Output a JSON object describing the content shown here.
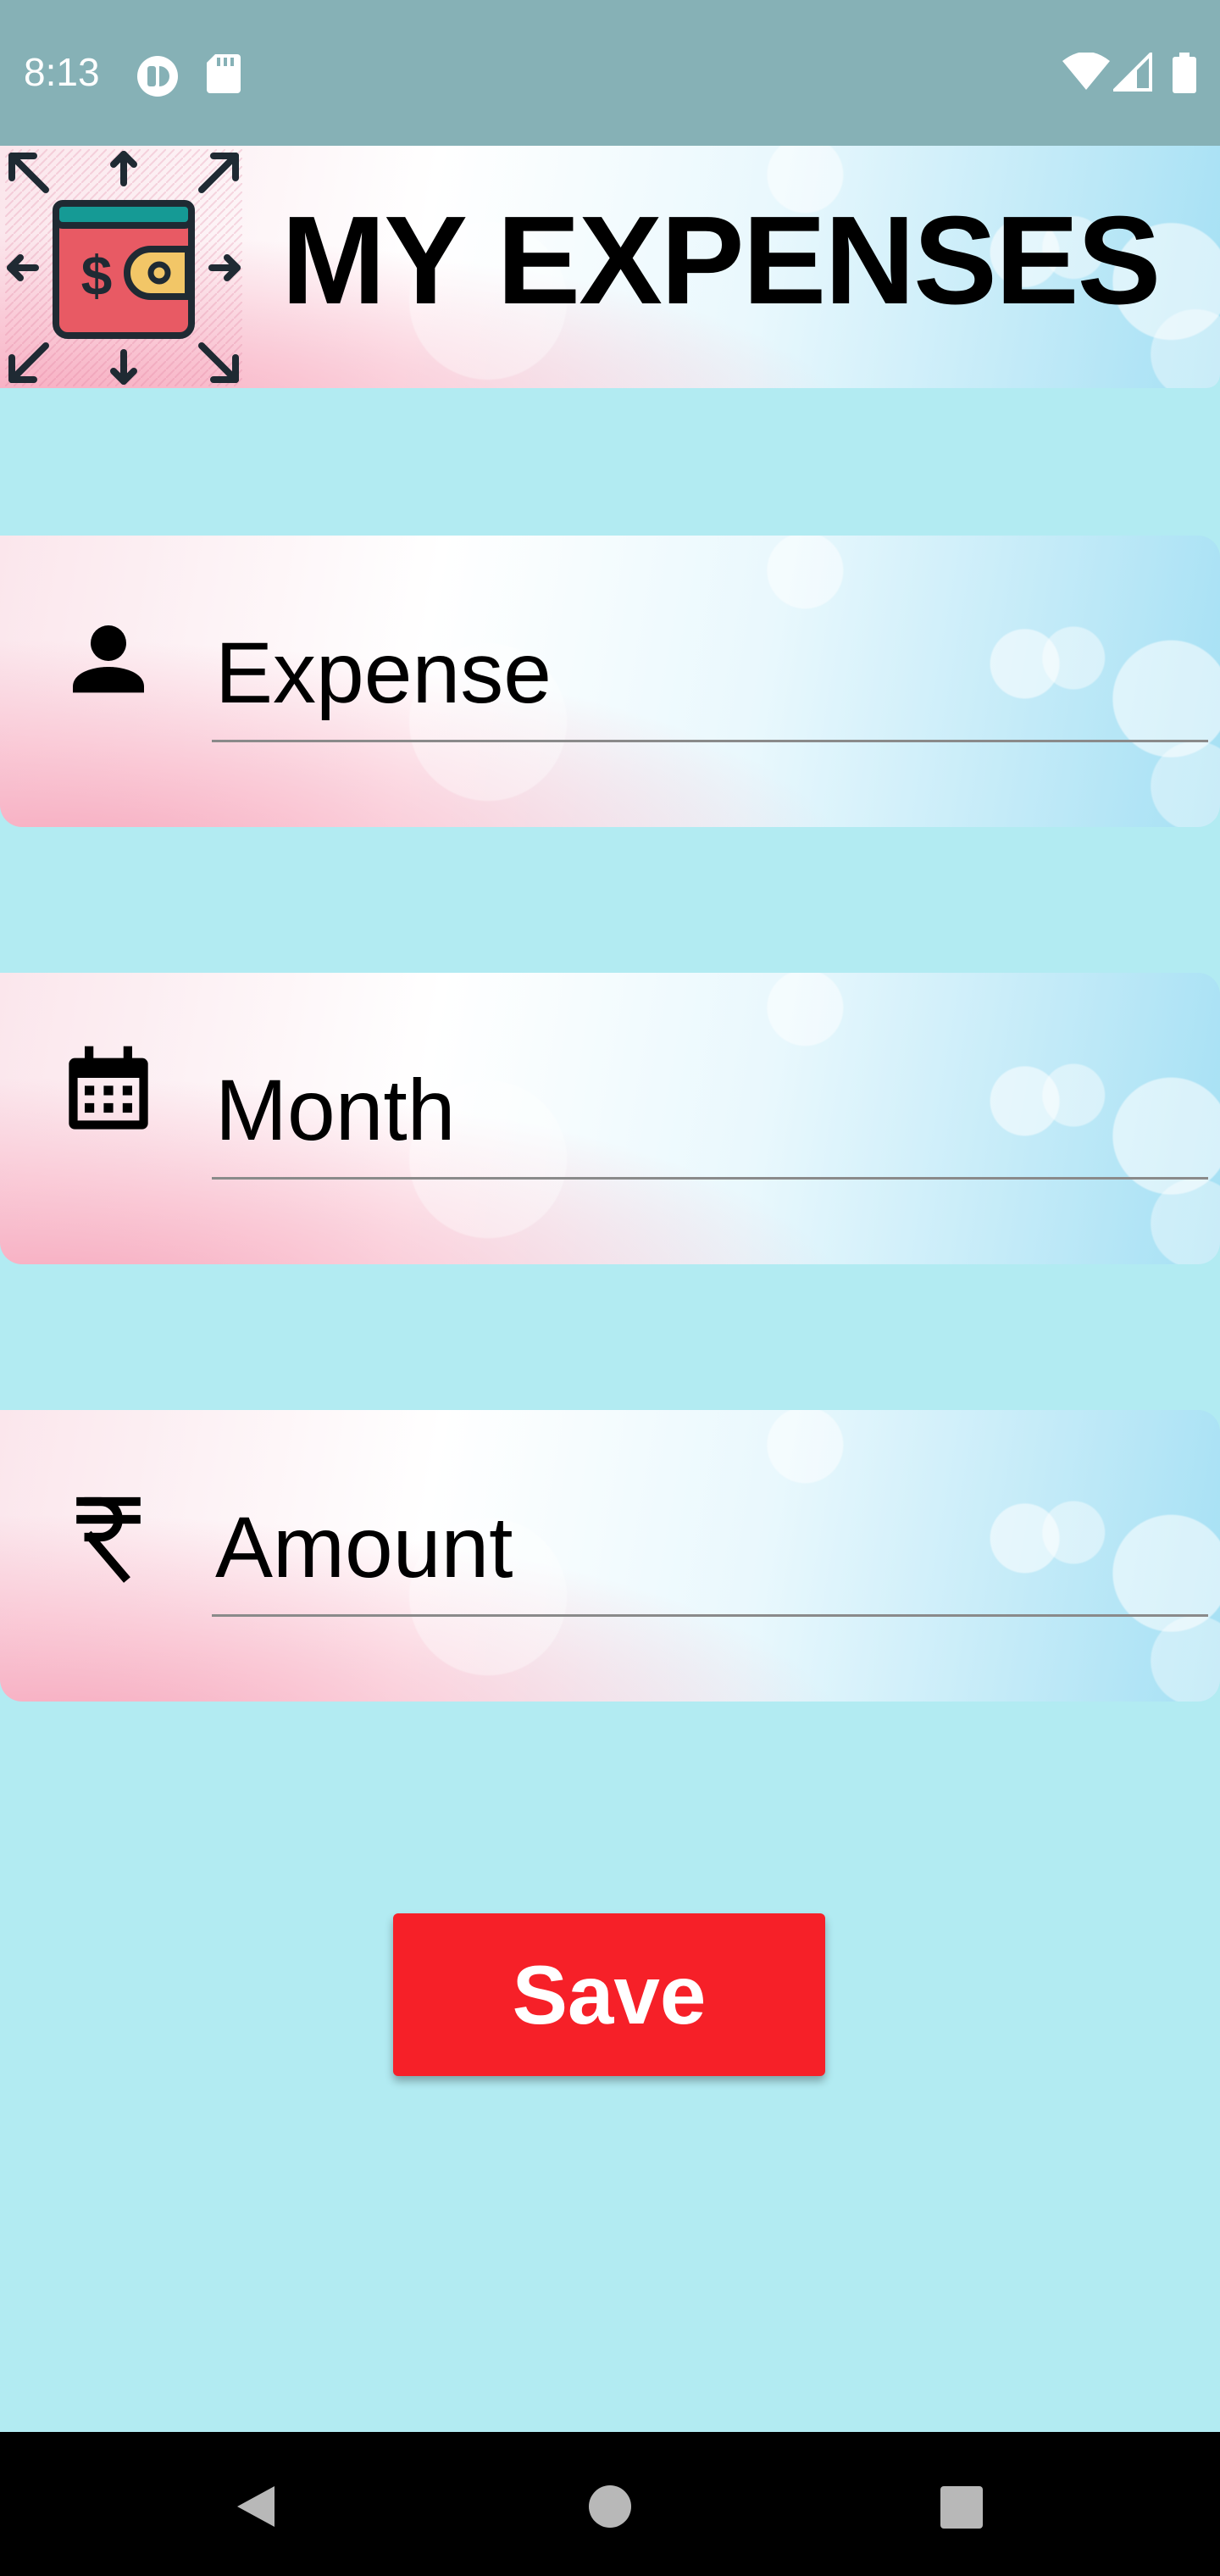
{
  "status_bar": {
    "time": "8:13",
    "left_icons": [
      "sync-circle-icon",
      "sd-card-icon"
    ],
    "right_icons": [
      "wifi-icon",
      "cell-signal-icon",
      "battery-icon"
    ]
  },
  "header": {
    "title": "MY EXPENSES",
    "logo_icon": "wallet-expenses-icon"
  },
  "form": {
    "fields": [
      {
        "icon": "person-icon",
        "placeholder": "Expense",
        "value": ""
      },
      {
        "icon": "calendar-icon",
        "placeholder": "Month",
        "value": ""
      },
      {
        "icon": "rupee-icon",
        "placeholder": "Amount",
        "value": ""
      }
    ],
    "save_label": "Save"
  },
  "nav_bar": {
    "buttons": [
      "back-icon",
      "home-icon",
      "recents-icon"
    ]
  },
  "colors": {
    "background": "#b2ebf2",
    "status_bar": "#86b1b6",
    "save_button": "#f62028",
    "nav_bar": "#000000"
  }
}
